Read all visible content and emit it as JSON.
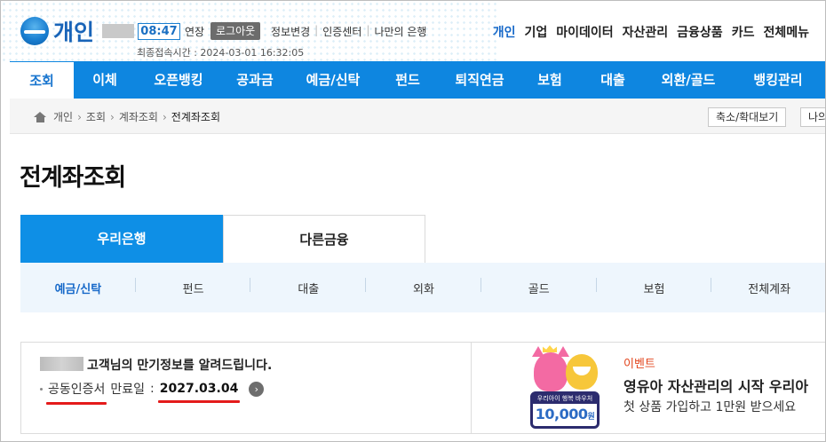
{
  "header": {
    "logo_text": "개인",
    "timer": "08:47",
    "extend_label": "연장",
    "logout_label": "로그아웃",
    "top_links": [
      "정보변경",
      "인증센터",
      "나만의 은행"
    ],
    "last_login": "최종접속시간 : 2024-03-01 16:32:05",
    "gnb": [
      "개인",
      "기업",
      "마이데이터",
      "자산관리",
      "금융상품",
      "카드",
      "전체메뉴"
    ],
    "gnb_active": "개인"
  },
  "main_nav": {
    "items": [
      "조회",
      "이체",
      "오픈뱅킹",
      "공과금",
      "예금/신탁",
      "펀드",
      "퇴직연금",
      "보험",
      "대출",
      "외환/골드",
      "뱅킹관리"
    ],
    "active": "조회"
  },
  "breadcrumb": {
    "items": [
      "개인",
      "조회",
      "계좌조회"
    ],
    "current": "전계좌조회",
    "zoom_button": "축소/확대보기",
    "my_button": "나의"
  },
  "page_title": "전계좌조회",
  "tabs": [
    {
      "label": "우리은행",
      "active": true
    },
    {
      "label": "다른금융",
      "active": false
    }
  ],
  "subtabs": {
    "items": [
      "예금/신탁",
      "펀드",
      "대출",
      "외화",
      "골드",
      "보험",
      "전체계좌"
    ],
    "active": "예금/신탁"
  },
  "maturity": {
    "notice": "고객님의 만기정보를 알려드립니다.",
    "cert_label": "공동인증서",
    "expiry_label": "만료일",
    "colon": ":",
    "expiry_date": "2027.03.04",
    "go_icon": "chevron-right-icon"
  },
  "event": {
    "label": "이벤트",
    "title": "영유아 자산관리의 시작 우리아",
    "subtitle": "첫 상품 가입하고 1만원 받으세요",
    "card_label": "우리아이 행복 바우처",
    "card_amount": "10,000",
    "card_unit": "원"
  },
  "colors": {
    "brand_blue": "#0e86e0",
    "accent_red": "#e41b1b",
    "event_orange": "#e2451d"
  }
}
